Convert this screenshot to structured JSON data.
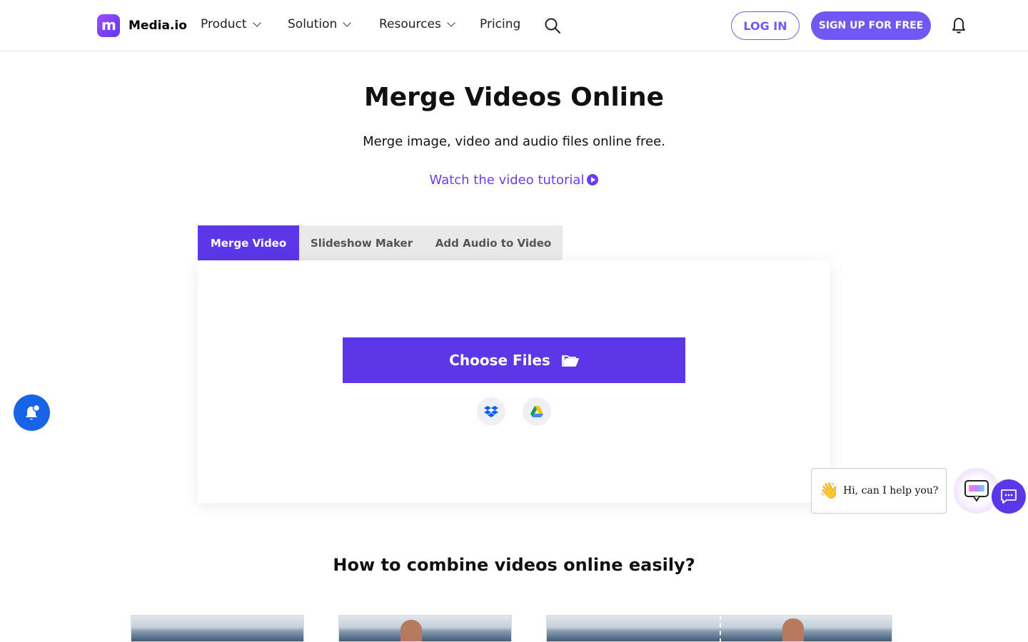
{
  "nav": {
    "logo_text": "Media.io",
    "logo_letter": "m",
    "items": [
      {
        "label": "Product"
      },
      {
        "label": "Solution"
      },
      {
        "label": "Resources"
      },
      {
        "label": "Pricing"
      }
    ],
    "login_label": "LOG IN",
    "signup_label": "SIGN UP FOR FREE"
  },
  "hero": {
    "title": "Merge Videos Online",
    "subtitle": "Merge image, video and audio files online free.",
    "tutorial_link": "Watch the video tutorial"
  },
  "tabs": [
    {
      "label": "Merge Video",
      "active": true
    },
    {
      "label": "Slideshow Maker",
      "active": false
    },
    {
      "label": "Add Audio to Video",
      "active": false
    }
  ],
  "upload": {
    "choose_label": "Choose Files",
    "sources": [
      "dropbox-icon",
      "google-drive-icon"
    ]
  },
  "how_to": {
    "heading": "How to combine videos online easily?"
  },
  "chat": {
    "greeting": "Hi, can I help you?"
  },
  "colors": {
    "accent": "#5b37e8",
    "brand_purple": "#7158f4",
    "link": "#6a3ef0",
    "notify_blue": "#1565e6"
  }
}
